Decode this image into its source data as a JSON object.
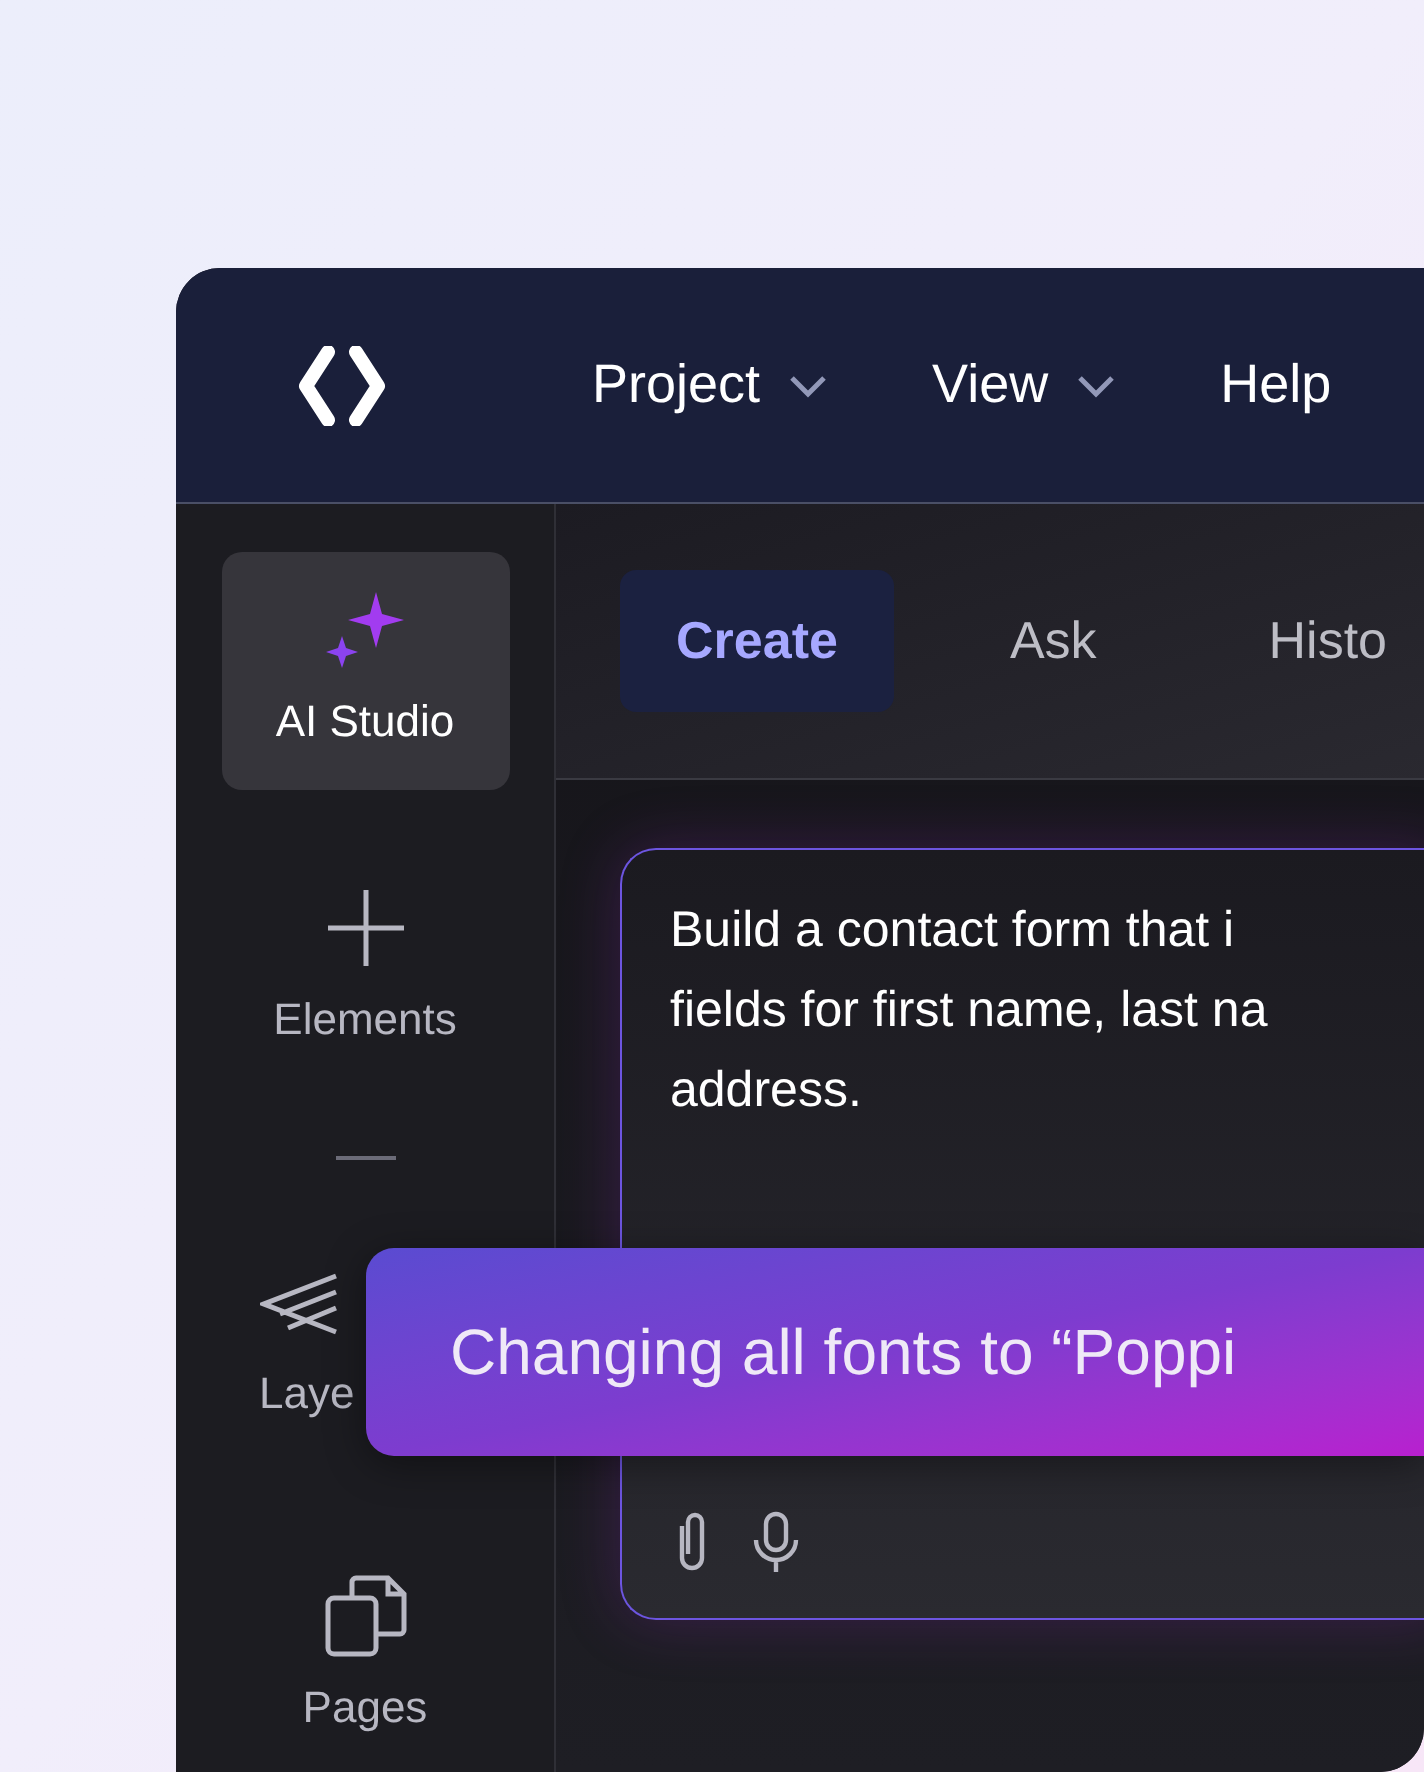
{
  "menu": [
    {
      "label": "Project",
      "dropdown": true
    },
    {
      "label": "View",
      "dropdown": true
    },
    {
      "label": "Help",
      "dropdown": false
    }
  ],
  "sidebar": {
    "items": [
      {
        "label": "AI Studio",
        "selected": true,
        "kind": "sparkle"
      },
      {
        "label": "Elements",
        "selected": false,
        "kind": "plus"
      },
      {
        "label": "Laye",
        "selected": false,
        "kind": "layers"
      },
      {
        "label": "Pages",
        "selected": false,
        "kind": "pages"
      }
    ]
  },
  "tabs": [
    {
      "label": "Create",
      "selected": true
    },
    {
      "label": "Ask",
      "selected": false
    },
    {
      "label": "Histo",
      "selected": false
    }
  ],
  "prompt": {
    "lines": [
      "Build a contact form that i",
      "fields for first name, last na",
      "address."
    ]
  },
  "toast": {
    "text": "Changing all fonts to “Poppi"
  }
}
